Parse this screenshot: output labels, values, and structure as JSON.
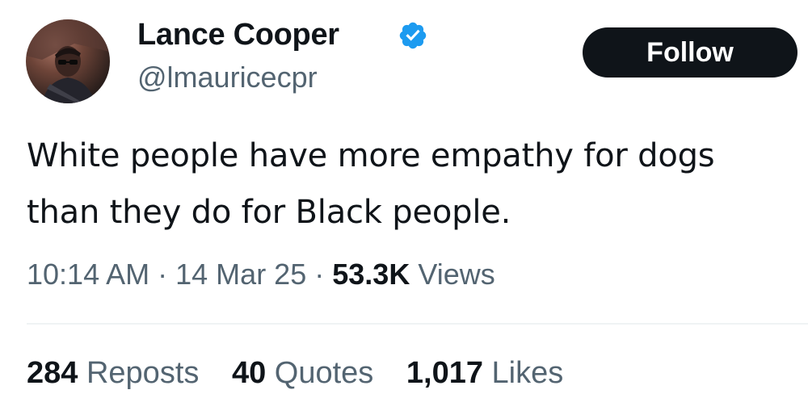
{
  "author": {
    "display_name": "Lance Cooper",
    "handle": "@lmauricecpr",
    "verified_icon": "verified-badge-icon",
    "verified_color": "#1d9bf0"
  },
  "actions": {
    "follow_label": "Follow"
  },
  "tweet": {
    "text": "White people have more empathy for dogs than they do for Black people.",
    "time": "10:14 AM",
    "separator": "·",
    "date": "14 Mar 25",
    "views_count": "53.3K",
    "views_label": "Views"
  },
  "stats": {
    "reposts_count": "284",
    "reposts_label": "Reposts",
    "quotes_count": "40",
    "quotes_label": "Quotes",
    "likes_count": "1,017",
    "likes_label": "Likes"
  },
  "colors": {
    "text_primary": "#0f1419",
    "text_secondary": "#536471",
    "button_bg": "#0f1419",
    "divider": "#eff3f4"
  }
}
